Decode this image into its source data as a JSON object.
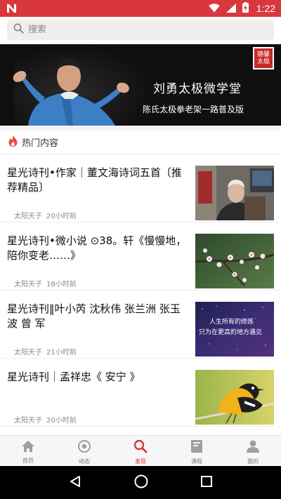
{
  "status_bar": {
    "time": "1:22",
    "app_icon": "n-icon",
    "icons": [
      "wifi-icon",
      "signal-icon",
      "battery-icon"
    ],
    "background": "#d8383d"
  },
  "search": {
    "placeholder": "搜索",
    "icon": "search-icon"
  },
  "banner": {
    "title": "刘勇太极微学堂",
    "subtitle": "陈氏太极拳老架一路普及版",
    "seal_text": "德馨太极"
  },
  "section": {
    "icon": "flame-icon",
    "label": "热门内容",
    "accent": "#e8453c"
  },
  "articles": [
    {
      "title": "星光诗刊•作家｜董文海诗词五首〔推荐精品〕",
      "author": "太阳天子",
      "time": "20小时前",
      "thumb": "man-portrait-thumbnail"
    },
    {
      "title": "星光诗刊•微小说 ⊙38。轩《慢慢地，陪你变老……》",
      "author": "太阳天子",
      "time": "18小时前",
      "thumb": "blossom-branch-thumbnail"
    },
    {
      "title": "星光诗刊‖叶小芮 沈秋伟 张兰洲 张玉波 曾 军",
      "author": "太阳天子",
      "time": "21小时前",
      "thumb": "starry-sky-quote-thumbnail",
      "thumb_text": "人生所有的修炼 只为在更高的地方遇见"
    },
    {
      "title": "星光诗刊｜孟祥忠《 安宁 》",
      "author": "太阳天子",
      "time": "20小时前",
      "thumb": "bird-thumbnail"
    }
  ],
  "bottom_nav": [
    {
      "label": "首页",
      "icon": "home-icon",
      "active": false
    },
    {
      "label": "动态",
      "icon": "activity-icon",
      "active": false
    },
    {
      "label": "发现",
      "icon": "search-icon",
      "active": true
    },
    {
      "label": "课程",
      "icon": "book-icon",
      "active": false
    },
    {
      "label": "我的",
      "icon": "user-icon",
      "active": false
    }
  ],
  "colors": {
    "brand": "#d8383d",
    "nav_inactive": "#9e9e9e",
    "nav_active": "#d8383d"
  }
}
